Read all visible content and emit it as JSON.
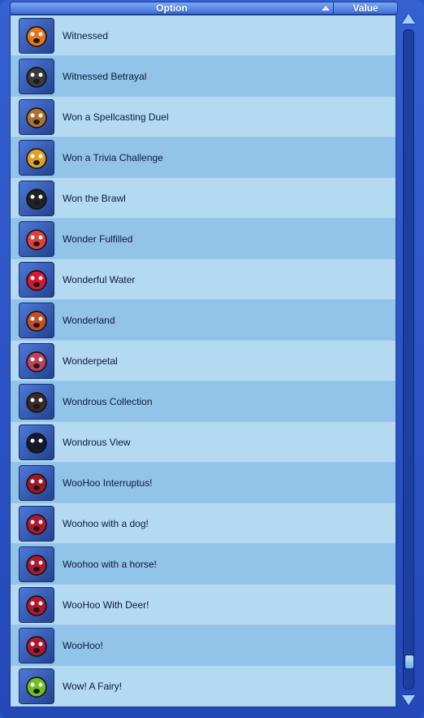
{
  "header": {
    "option_label": "Option",
    "value_label": "Value"
  },
  "rows": [
    {
      "label": "Witnessed",
      "icon": "ghost-face-icon",
      "color": "#e8751a"
    },
    {
      "label": "Witnessed Betrayal",
      "icon": "eyes-dagger-icon",
      "color": "#3a3a3a"
    },
    {
      "label": "Won a Spellcasting Duel",
      "icon": "crossed-wands-icon",
      "color": "#b07030"
    },
    {
      "label": "Won a Trivia Challenge",
      "icon": "trophy-icon",
      "color": "#e0a020"
    },
    {
      "label": "Won the Brawl",
      "icon": "victory-figure-icon",
      "color": "#222222"
    },
    {
      "label": "Wonder Fulfilled",
      "icon": "rainbow-figure-icon",
      "color": "#e0403a"
    },
    {
      "label": "Wonderful Water",
      "icon": "heart-splash-icon",
      "color": "#d81830"
    },
    {
      "label": "Wonderland",
      "icon": "rainbow-icon",
      "color": "#c05028"
    },
    {
      "label": "Wonderpetal",
      "icon": "flower-icon",
      "color": "#c04060"
    },
    {
      "label": "Wondrous Collection",
      "icon": "vase-icon",
      "color": "#3a2a2a"
    },
    {
      "label": "Wondrous View",
      "icon": "eiffel-tower-icon",
      "color": "#141a30"
    },
    {
      "label": "WooHoo Interruptus!",
      "icon": "broken-heart-icon",
      "color": "#a01828"
    },
    {
      "label": "Woohoo with a dog!",
      "icon": "heart-face-icon",
      "color": "#b01830"
    },
    {
      "label": "Woohoo with a horse!",
      "icon": "heart-face-icon",
      "color": "#b01830"
    },
    {
      "label": "WooHoo With Deer!",
      "icon": "heart-face-icon",
      "color": "#b01830"
    },
    {
      "label": "WooHoo!",
      "icon": "heart-face-icon",
      "color": "#b01830"
    },
    {
      "label": "Wow! A Fairy!",
      "icon": "green-face-icon",
      "color": "#6cc020"
    }
  ],
  "scrollbar": {
    "position": 0.97
  }
}
